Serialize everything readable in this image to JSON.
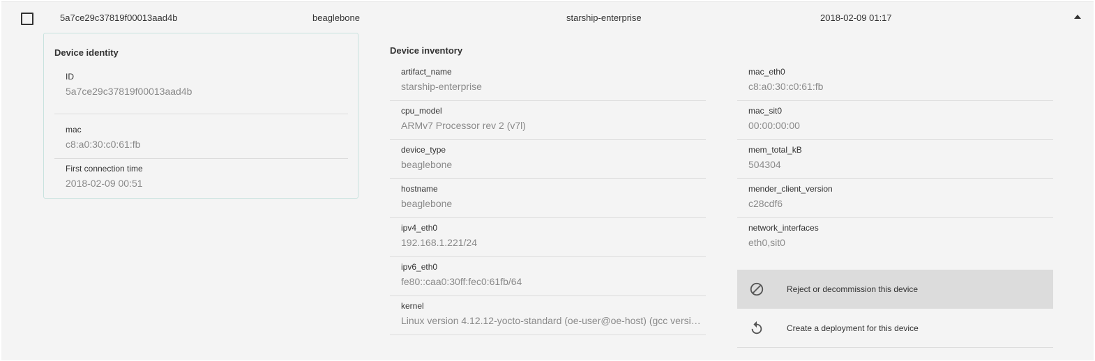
{
  "device_row": {
    "id": "5a7ce29c37819f00013aad4b",
    "device_type": "beaglebone",
    "artifact_name": "starship-enterprise",
    "last_checkin": "2018-02-09 01:17",
    "checkbox_checked": false,
    "expanded": true
  },
  "identity": {
    "title": "Device identity",
    "fields": [
      {
        "key": "ID",
        "value": "5a7ce29c37819f00013aad4b"
      },
      {
        "key": "mac",
        "value": "c8:a0:30:c0:61:fb"
      },
      {
        "key": "First connection time",
        "value": "2018-02-09 00:51"
      }
    ]
  },
  "inventory": {
    "title": "Device inventory",
    "left": [
      {
        "key": "artifact_name",
        "value": "starship-enterprise"
      },
      {
        "key": "cpu_model",
        "value": "ARMv7 Processor rev 2 (v7l)"
      },
      {
        "key": "device_type",
        "value": "beaglebone"
      },
      {
        "key": "hostname",
        "value": "beaglebone"
      },
      {
        "key": "ipv4_eth0",
        "value": "192.168.1.221/24"
      },
      {
        "key": "ipv6_eth0",
        "value": "fe80::caa0:30ff:fec0:61fb/64"
      },
      {
        "key": "kernel",
        "value": "Linux version 4.12.12-yocto-standard (oe-user@oe-host) (gcc versio..."
      }
    ],
    "right": [
      {
        "key": "mac_eth0",
        "value": "c8:a0:30:c0:61:fb"
      },
      {
        "key": "mac_sit0",
        "value": "00:00:00:00"
      },
      {
        "key": "mem_total_kB",
        "value": "504304"
      },
      {
        "key": "mender_client_version",
        "value": "c28cdf6"
      },
      {
        "key": "network_interfaces",
        "value": "eth0,sit0"
      }
    ]
  },
  "actions": [
    {
      "label": "Reject or decommission this device",
      "icon": "block-icon",
      "highlighted": true
    },
    {
      "label": "Create a deployment for this device",
      "icon": "replay-icon",
      "highlighted": false
    }
  ],
  "colors": {
    "panel_bg": "#f4f4f4",
    "card_border": "#c8e2de",
    "value_text": "#8a8a8a",
    "highlight_bg": "#dcdcdc"
  }
}
